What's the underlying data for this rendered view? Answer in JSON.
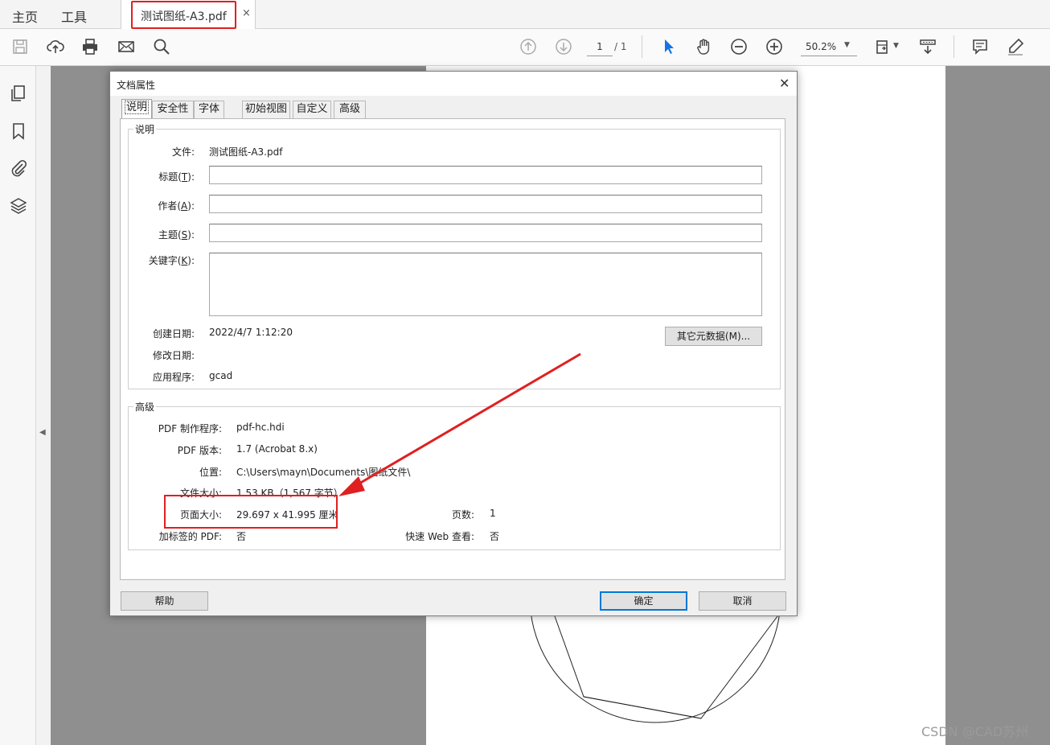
{
  "menubar": {
    "home": "主页",
    "tools": "工具"
  },
  "tab": {
    "title": "测试图纸-A3.pdf",
    "close": "×"
  },
  "toolbar": {
    "page_current": "1",
    "page_total": "/ 1",
    "zoom": "50.2%"
  },
  "dialog": {
    "title": "文档属性",
    "tabs": [
      "说明",
      "安全性",
      "字体",
      "初始视图",
      "自定义",
      "高级"
    ],
    "description_group": "说明",
    "file_label": "文件:",
    "file_value": "测试图纸-A3.pdf",
    "title_label": "标题",
    "title_key": "T",
    "author_label": "作者",
    "author_key": "A",
    "subject_label": "主题",
    "subject_key": "S",
    "keywords_label": "关键字",
    "keywords_key": "K",
    "title_value": "",
    "author_value": "",
    "subject_value": "",
    "keywords_value": "",
    "created_label": "创建日期:",
    "created_value": "2022/4/7 1:12:20",
    "modified_label": "修改日期:",
    "modified_value": "",
    "app_label": "应用程序:",
    "app_value": "gcad",
    "metadata_button": "其它元数据(M)...",
    "advanced_group": "高级",
    "producer_label": "PDF 制作程序:",
    "producer_value": "pdf-hc.hdi",
    "version_label": "PDF 版本:",
    "version_value": "1.7 (Acrobat 8.x)",
    "location_label": "位置:",
    "location_value": "C:\\Users\\mayn\\Documents\\图纸文件\\",
    "filesize_label": "文件大小:",
    "filesize_value": "1.53 KB（1,567 字节）",
    "pagesize_label": "页面大小:",
    "pagesize_value": "29.697 x 41.995 厘米",
    "pages_label": "页数:",
    "pages_value": "1",
    "tagged_label": "加标签的 PDF:",
    "tagged_value": "否",
    "fastweb_label": "快速 Web 查看:",
    "fastweb_value": "否",
    "help_button": "帮助",
    "ok_button": "确定",
    "cancel_button": "取消"
  },
  "watermark": "CSDN @CAD苏州",
  "colors": {
    "highlight": "#e02020",
    "accent": "#0078d7",
    "select_tool": "#1473e6"
  }
}
